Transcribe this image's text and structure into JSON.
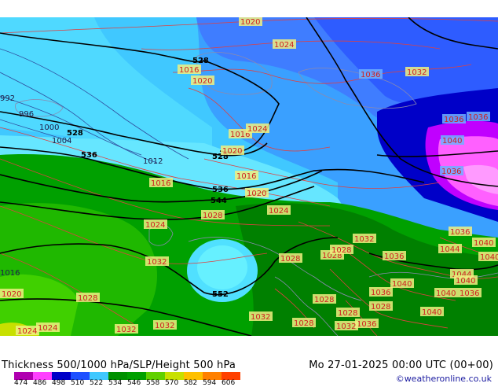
{
  "footer": {
    "title": "Thickness 500/1000 hPa/SLP/Height 500 hPa",
    "date": "Mo 27-01-2025 00:00 UTC (00+00)",
    "credit": "©weatheronline.co.uk"
  },
  "scale": {
    "ticks": [
      "474",
      "486",
      "498",
      "510",
      "522",
      "534",
      "546",
      "558",
      "570",
      "582",
      "594",
      "606"
    ],
    "colors": [
      "#b000b0",
      "#ff40ff",
      "#0000c8",
      "#1e50ff",
      "#40c8ff",
      "#009000",
      "#00a000",
      "#60d000",
      "#c8e000",
      "#ffc000",
      "#ff8000",
      "#ff4000"
    ]
  },
  "height_labels": [
    "528",
    "528",
    "536",
    "528",
    "536",
    "544",
    "552"
  ],
  "slp_labels": [
    "1020",
    "1024",
    "1016",
    "1020",
    "1036",
    "1032",
    "992",
    "996",
    "1000",
    "1004",
    "1016",
    "1024",
    "1036",
    "1036",
    "1020",
    "1012",
    "1016",
    "1016",
    "1020",
    "1040",
    "1036",
    "1028",
    "1024",
    "1024",
    "1032",
    "1036",
    "1040",
    "1032",
    "1028",
    "1028",
    "1036",
    "1044",
    "1040",
    "1016",
    "1028",
    "1020",
    "1028",
    "1044",
    "1040",
    "1040",
    "1036",
    "1028",
    "1040",
    "1036",
    "1028",
    "1028",
    "1040",
    "1024",
    "1032",
    "1032",
    "1032",
    "1028",
    "1036",
    "1032",
    "1024"
  ]
}
